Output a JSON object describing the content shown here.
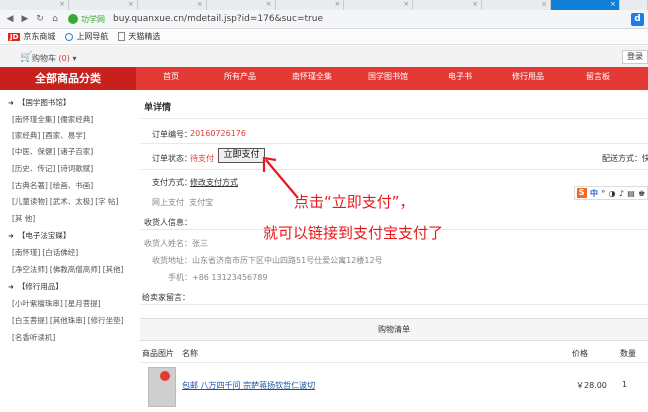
{
  "browser": {
    "address": {
      "site_name": "功学网",
      "url": "buy.quanxue.cn/mdetail.jsp?id=176&suc=true"
    },
    "bookmarks": [
      {
        "label": "京东商城",
        "badge": "JD"
      },
      {
        "label": "上网导航"
      },
      {
        "label": "天猫精选"
      }
    ]
  },
  "site": {
    "cart_label": "购物车",
    "cart_count": "(0)",
    "cart_caret": "▾",
    "login_label": "登录",
    "nav": {
      "all_categories": "全部商品分类",
      "items": [
        "首页",
        "所有产品",
        "南怀瑾全集",
        "国学图书馆",
        "电子书",
        "修行用品",
        "留言板"
      ]
    }
  },
  "sidebar": {
    "groups": [
      {
        "title": "【国学图书馆】",
        "rows": [
          [
            "[南怀瑾全集]",
            "[儒家经典]"
          ],
          [
            "[家经典]",
            "[酉家、易学]"
          ],
          [
            "[中医、保健]",
            "[诸子百家]"
          ],
          [
            "[历史、传记]",
            "[诗词歌赋]"
          ],
          [
            "[古典名著]",
            "[绘画、书画]"
          ],
          [
            "[儿童读物]",
            "[武术、太极]",
            "[字 帖]"
          ],
          [
            "[其 他]"
          ]
        ]
      },
      {
        "title": "【电子法宝碟】",
        "rows": [
          [
            "[南怀瑾]",
            "[白话佛经]"
          ],
          [
            "[净空法师]",
            "[佛教高僧高师]",
            "[其他]"
          ]
        ]
      },
      {
        "title": "【修行用品】",
        "rows": [
          [
            "[小叶紫檀珠串]",
            "[星月菩提]"
          ],
          [
            "[白玉菩提]",
            "[其他珠串]",
            "[修行坐垫]"
          ],
          [
            "[名香听读机]"
          ]
        ]
      }
    ]
  },
  "order": {
    "title": "单详情",
    "number_label": "订单编号：",
    "number_value": "20160726176",
    "status_label": "订单状态：",
    "status_value": "待支付",
    "pay_button": "立即支付",
    "delivery_label": "配送方式：快",
    "pay_method_label": "支付方式：",
    "pay_method_link": "修改支付方式",
    "pay_method_options": "网上支付  支付宝",
    "receiver_header": "收货人信息：",
    "receiver_name": "收货人姓名：张三",
    "receiver_address": "收货地址：山东省济南市历下区中山四路51号仕爱公寓12楼12号",
    "receiver_phone": "手机：+86 13123456789",
    "seller_message": "给卖家留言："
  },
  "annotation": {
    "line1": "点击“立即支付”，",
    "line2": "就可以链接到支付宝支付了",
    "color": "#e8181c"
  },
  "ime": {
    "logo": "S",
    "lang": "中",
    "glyphs": [
      "°",
      "◑",
      "♪",
      "▤",
      "♚"
    ]
  },
  "cart_list": {
    "title": "购物清单",
    "headers": {
      "image": "商品图片",
      "name": "名称",
      "price": "价格",
      "qty": "数量"
    },
    "items": [
      {
        "name": "包邮 八万四千问 宗萨蒋扬钦哲仁波切",
        "price": "￥28.00",
        "qty": "1"
      }
    ]
  },
  "colors": {
    "brand_red": "#e33a36",
    "dark_red": "#c8201d",
    "link_blue": "#1a4fa0"
  }
}
